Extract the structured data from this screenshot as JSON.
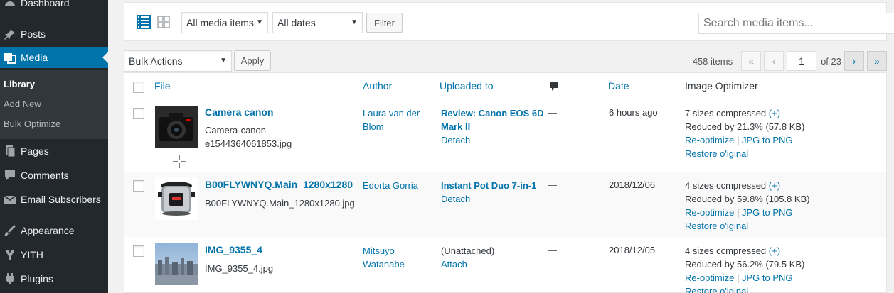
{
  "sidebar": {
    "items": [
      {
        "label": "Dashboard",
        "icon": "dashboard-icon"
      },
      {
        "label": "Posts",
        "icon": "pin-icon"
      },
      {
        "label": "Media",
        "icon": "media-icon",
        "current": true
      },
      {
        "label": "Pages",
        "icon": "pages-icon"
      },
      {
        "label": "Comments",
        "icon": "comment-icon"
      },
      {
        "label": "Email Subscribers",
        "icon": "email-icon"
      },
      {
        "label": "Appearance",
        "icon": "brush-icon"
      },
      {
        "label": "YITH",
        "icon": "yith-icon"
      },
      {
        "label": "Plugins",
        "icon": "plugin-icon"
      }
    ],
    "submenu": [
      {
        "label": "Library",
        "current": true
      },
      {
        "label": "Add New"
      },
      {
        "label": "Bulk Optimize"
      }
    ]
  },
  "filters": {
    "media_type": "All media items",
    "dates": "All dates",
    "filter_label": "Filter",
    "search_placeholder": "Search media items..."
  },
  "bulk": {
    "action": "Bulk Acticns",
    "apply_label": "Apply"
  },
  "pagination": {
    "count": "458 items",
    "first": "«",
    "prev": "‹",
    "current": "1",
    "total": "of 23",
    "next": "›",
    "last": "»"
  },
  "columns": {
    "file": "File",
    "author": "Author",
    "uploaded": "Uploaded to",
    "date": "Date",
    "optimizer": "Image Optimizer"
  },
  "rows": [
    {
      "title": "Camera canon",
      "filename_line1": "Camera-canon-",
      "filename_line2": "e1544364061853.jpg",
      "author_line1": "Laura van der",
      "author_line2": "Blom",
      "uploaded_title_line1": "Review: Canon EOS 6D",
      "uploaded_title_line2": "Mark II",
      "uploaded_link": "Detach",
      "comments": "—",
      "date": "6 hours ago",
      "opt_sizes": "7 sizes ccmpressed",
      "opt_plus": "(+)",
      "opt_reduced": "Reduced by 21.3% (57.8 KB)",
      "opt_reoptimize": "Re-optimize",
      "opt_sep": " | ",
      "opt_convert": "JPG to PNG",
      "opt_restore": "Restore o'iginal"
    },
    {
      "title": "B00FLYWNYQ.Main_1280x1280",
      "filename_line1": "B00FLYWNYQ.Main_1280x1280.jpg",
      "author_line1": "Edorta Gorria",
      "uploaded_title_line1": "Instant Pot Duo 7-in-1",
      "uploaded_link": "Detach",
      "comments": "—",
      "date": "2018/12/06",
      "opt_sizes": "4 sizes ccmpressed",
      "opt_plus": "(+)",
      "opt_reduced": "Reduced by 59.8% (105.8 KB)",
      "opt_reoptimize": "Re-optimize",
      "opt_sep": " | ",
      "opt_convert": "JPG to PNG",
      "opt_restore": "Restore o'iginal"
    },
    {
      "title": "IMG_9355_4",
      "filename_line1": "IMG_9355_4.jpg",
      "author_line1": "Mitsuyo",
      "author_line2": "Watanabe",
      "uploaded_plain": "(Unattached)",
      "uploaded_link": "Attach",
      "comments": "—",
      "date": "2018/12/05",
      "opt_sizes": "4 sizes ccmpressed",
      "opt_plus": "(+)",
      "opt_reduced": "Reduced by 56.2% (79.5 KB)",
      "opt_reoptimize": "Re-optimize",
      "opt_sep": " | ",
      "opt_convert": "JPG to PNG",
      "opt_restore": "Restore o'iginal"
    }
  ],
  "colors": {
    "sidebar_bg": "#23282d",
    "accent": "#0073aa",
    "link": "#0073aa"
  }
}
